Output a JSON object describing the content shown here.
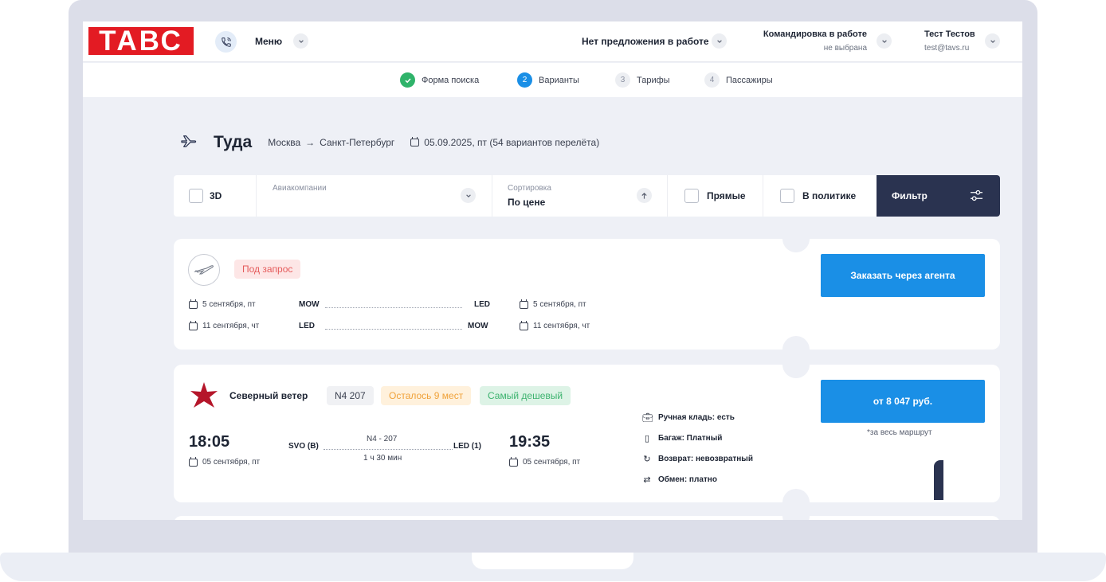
{
  "header": {
    "logo": "ТАВС",
    "menu_label": "Меню",
    "offers_label": "Нет предложения в работе",
    "trip_label": "Командировка в работе",
    "trip_status": "не выбрана",
    "user_name": "Тест Тестов",
    "user_email": "test@tavs.ru"
  },
  "steps": [
    {
      "num": "✓",
      "label": "Форма поиска",
      "state": "done"
    },
    {
      "num": "2",
      "label": "Варианты",
      "state": "active"
    },
    {
      "num": "3",
      "label": "Тарифы",
      "state": "pending"
    },
    {
      "num": "4",
      "label": "Пассажиры",
      "state": "pending"
    }
  ],
  "route": {
    "title": "Туда",
    "from": "Москва",
    "arrow": "→",
    "to": "Санкт-Петербург",
    "date_info": "05.09.2025, пт (54 вариантов перелёта)"
  },
  "filters": {
    "threeD_label": "3D",
    "airlines_label": "Авиакомпании",
    "sort_label": "Сортировка",
    "sort_value": "По цене",
    "direct_label": "Прямые",
    "policy_label": "В политике",
    "filter_button": "Фильтр"
  },
  "card1": {
    "tag": "Под запрос",
    "button": "Заказать через агента",
    "rows": [
      {
        "dep_date": "5 сентября, пт",
        "from": "MOW",
        "to": "LED",
        "arr_date": "5 сентября, пт"
      },
      {
        "dep_date": "11 сентября, чт",
        "from": "LED",
        "to": "MOW",
        "arr_date": "11 сентября, чт"
      }
    ]
  },
  "card2": {
    "airline": "Северный ветер",
    "flight_tag": "N4 207",
    "seats_tag": "Осталось 9 мест",
    "cheapest_tag": "Самый дешевый",
    "dep_time": "18:05",
    "dep_date": "05 сентября, пт",
    "dep_airport": "SVO (B)",
    "flight_no": "N4 - 207",
    "duration": "1 ч 30 мин",
    "arr_airport": "LED (1)",
    "arr_time": "19:35",
    "arr_date": "05 сентября, пт",
    "features": [
      {
        "icon": "briefcase-icon",
        "label": "Ручная кладь: есть"
      },
      {
        "icon": "luggage-icon",
        "label": "Багаж: Платный"
      },
      {
        "icon": "refund-icon",
        "label": "Возврат: невозвратный"
      },
      {
        "icon": "exchange-icon",
        "label": "Обмен: платно"
      }
    ],
    "price_button": "от 8 047 руб.",
    "price_note": "*за весь маршрут"
  },
  "colors": {
    "brand_red": "#e31b23",
    "accent_blue": "#1a8fe6",
    "dark_navy": "#2a3350",
    "success_green": "#2fb36a",
    "tag_red_bg": "#fde6e6",
    "tag_orange_bg": "#fff1dc",
    "tag_green_bg": "#ddf3e6"
  }
}
